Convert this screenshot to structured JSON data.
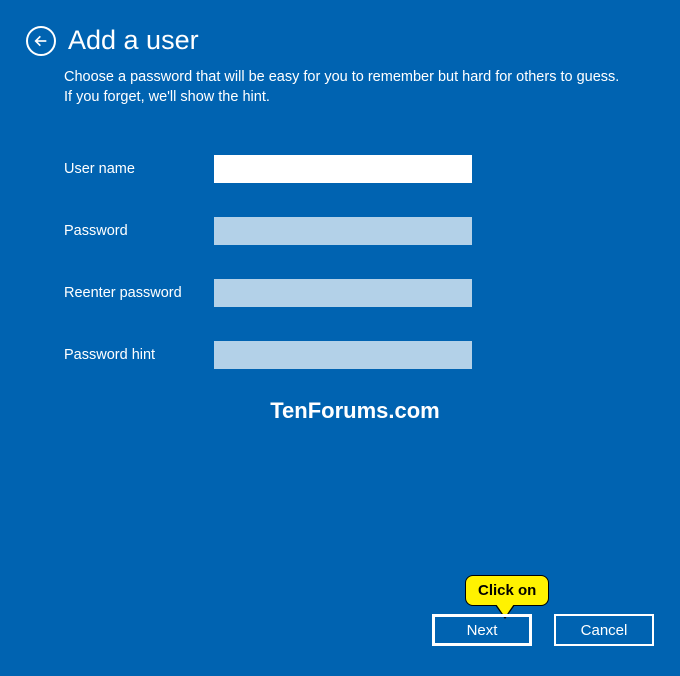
{
  "header": {
    "title": "Add a user"
  },
  "subtitle": "Choose a password that will be easy for you to remember but hard for others to guess. If you forget, we'll show the hint.",
  "form": {
    "username": {
      "label": "User name",
      "value": ""
    },
    "password": {
      "label": "Password",
      "value": ""
    },
    "reenter": {
      "label": "Reenter password",
      "value": ""
    },
    "hint": {
      "label": "Password hint",
      "value": ""
    }
  },
  "watermark": "TenForums.com",
  "buttons": {
    "next": "Next",
    "cancel": "Cancel"
  },
  "callout": {
    "text": "Click on"
  }
}
